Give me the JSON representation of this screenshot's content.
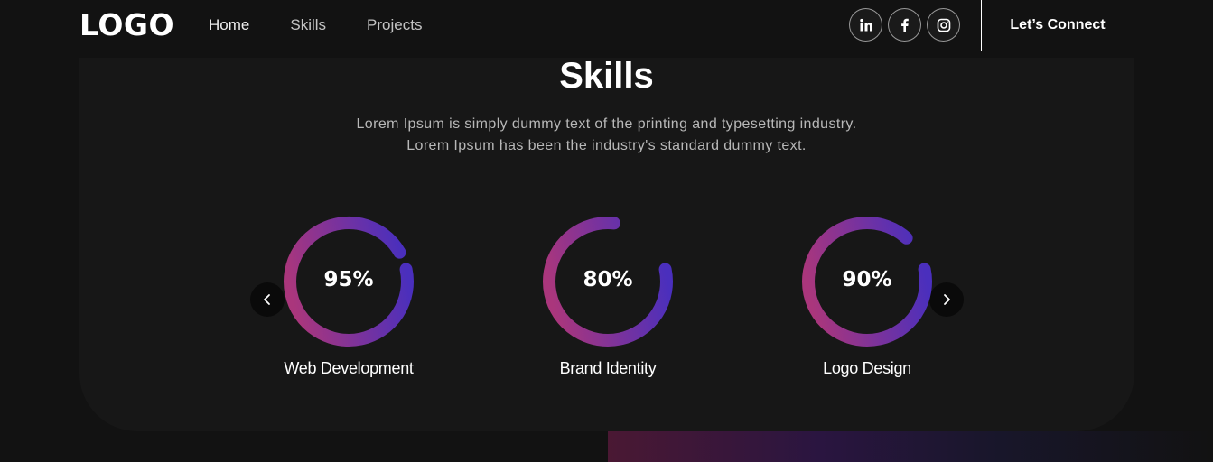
{
  "nav": {
    "logo": "LOGO",
    "links": [
      "Home",
      "Skills",
      "Projects"
    ],
    "socials": [
      "linkedin-icon",
      "facebook-icon",
      "instagram-icon"
    ],
    "connect_label": "Let’s Connect"
  },
  "skills": {
    "title": "Skills",
    "description": [
      "Lorem Ipsum is simply dummy text of the printing and typesetting industry.",
      "Lorem Ipsum has been the industry's standard dummy text."
    ],
    "items": [
      {
        "percent_label": "95%",
        "value": 95,
        "label": "Web Development"
      },
      {
        "percent_label": "80%",
        "value": 80,
        "label": "Brand Identity"
      },
      {
        "percent_label": "90%",
        "value": 90,
        "label": "Logo Design"
      }
    ]
  },
  "colors": {
    "background": "#121212",
    "card": "#171717",
    "ring_start": "#aa367c",
    "ring_end": "#4a2fbd"
  }
}
